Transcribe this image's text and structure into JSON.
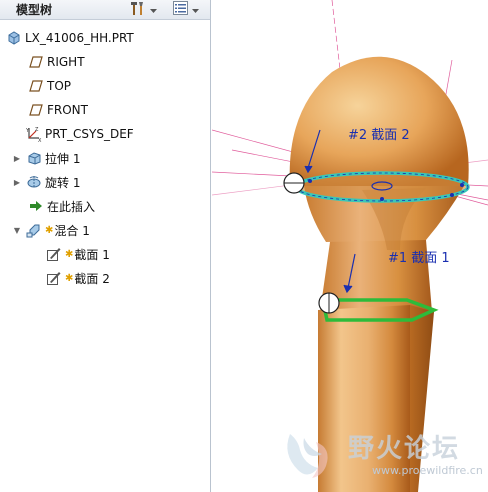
{
  "tree": {
    "title": "模型树",
    "items": [
      {
        "label": "LX_41006_HH.PRT",
        "icon": "part-icon"
      },
      {
        "label": "RIGHT",
        "icon": "datum-plane-icon"
      },
      {
        "label": "TOP",
        "icon": "datum-plane-icon"
      },
      {
        "label": "FRONT",
        "icon": "datum-plane-icon"
      },
      {
        "label": "PRT_CSYS_DEF",
        "icon": "csys-icon"
      },
      {
        "label": "拉伸 1",
        "icon": "extrude-icon"
      },
      {
        "label": "旋转 1",
        "icon": "revolve-icon"
      },
      {
        "label": "在此插入",
        "icon": "insert-here-arrow-icon"
      },
      {
        "label": "混合 1",
        "icon": "blend-icon"
      },
      {
        "label": "截面 1",
        "icon": "section-sketch-icon"
      },
      {
        "label": "截面 2",
        "icon": "section-sketch-icon"
      }
    ]
  },
  "viewport": {
    "section_label_2": "#2 截面 2",
    "section_label_1": "#1 截面 1",
    "watermark_main": "野火论坛",
    "watermark_sub": "www.proewildfire.cn"
  },
  "colors": {
    "section_outline_green": "#2dbb3a",
    "section_outline_cyan": "#39c7b8",
    "label_blue": "#1a2fb0",
    "datum_pink": "#e05a9a",
    "wood_light": "#f0b86a",
    "wood_dark": "#b86a22"
  }
}
